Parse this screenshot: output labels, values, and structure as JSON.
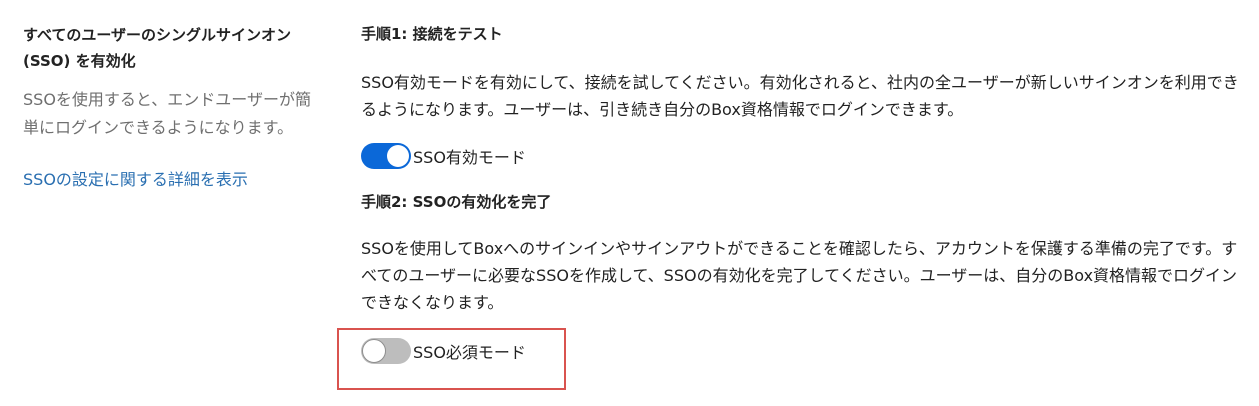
{
  "left": {
    "title": "すべてのユーザーのシングルサインオン (SSO) を有効化",
    "description": "SSOを使用すると、エンドユーザーが簡単にログインできるようになります。",
    "link_label": "SSOの設定に関する詳細を表示"
  },
  "step1": {
    "title": "手順1: 接続をテスト",
    "description": "SSO有効モードを有効にして、接続を試してください。有効化されると、社内の全ユーザーが新しいサインオンを利用できるようになります。ユーザーは、引き続き自分のBox資格情報でログインできます。",
    "toggle_label": "SSO有効モード",
    "toggle_state": "on"
  },
  "step2": {
    "title": "手順2: SSOの有効化を完了",
    "description": "SSOを使用してBoxへのサインインやサインアウトができることを確認したら、アカウントを保護する準備の完了です。すべてのユーザーに必要なSSOを作成して、SSOの有効化を完了してください。ユーザーは、自分のBox資格情報でログインできなくなります。",
    "toggle_label": "SSO必須モード",
    "toggle_state": "off"
  },
  "colors": {
    "toggle_on": "#0b68d8",
    "toggle_off": "#bdbdbd",
    "link": "#2a6fb1",
    "highlight": "#d9534f"
  }
}
